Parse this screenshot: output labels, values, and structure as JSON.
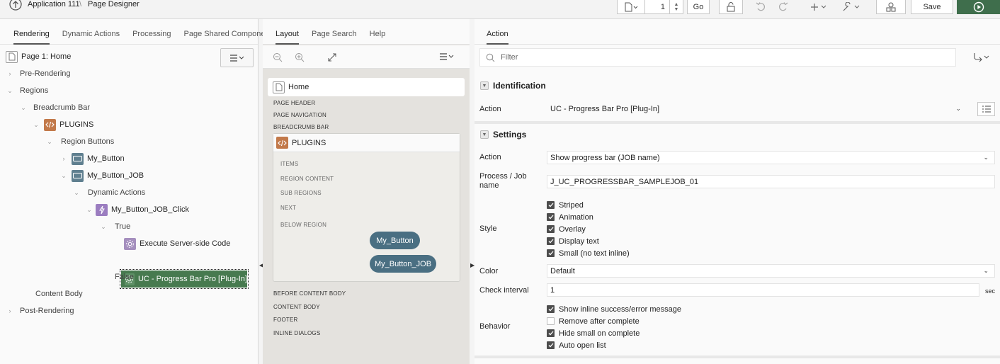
{
  "topbar": {
    "app": "Application 111",
    "separator": "\\",
    "page_title": "Page Designer",
    "page_number": "1",
    "go_label": "Go",
    "save_label": "Save"
  },
  "left": {
    "tabs": [
      "Rendering",
      "Dynamic Actions",
      "Processing",
      "Page Shared Componer"
    ],
    "page_label": "Page 1: Home",
    "tree": {
      "pre_rendering": "Pre-Rendering",
      "regions": "Regions",
      "breadcrumb_bar": "Breadcrumb Bar",
      "plugins": "PLUGINS",
      "region_buttons": "Region Buttons",
      "my_button": "My_Button",
      "my_button_job": "My_Button_JOB",
      "dynamic_actions": "Dynamic Actions",
      "click_da": "My_Button_JOB_Click",
      "true_branch": "True",
      "execute_server": "Execute Server-side Code",
      "uc_progress": "UC - Progress Bar Pro [Plug-In]",
      "false_branch": "False",
      "content_body": "Content Body",
      "post_rendering": "Post-Rendering"
    }
  },
  "mid": {
    "tabs": [
      "Layout",
      "Page Search",
      "Help"
    ],
    "home": "Home",
    "labels_top": [
      "PAGE HEADER",
      "PAGE NAVIGATION",
      "BREADCRUMB BAR"
    ],
    "plugins": "PLUGINS",
    "region_labels": [
      "ITEMS",
      "REGION CONTENT",
      "SUB REGIONS",
      "NEXT",
      "BELOW REGION"
    ],
    "buttons": [
      "My_Button",
      "My_Button_JOB"
    ],
    "labels_bottom": [
      "BEFORE CONTENT BODY",
      "CONTENT BODY",
      "FOOTER",
      "INLINE DIALOGS"
    ]
  },
  "right": {
    "tab": "Action",
    "filter_placeholder": "Filter",
    "identification": {
      "title": "Identification",
      "action_label": "Action",
      "action_value": "UC - Progress Bar Pro [Plug-In]"
    },
    "settings": {
      "title": "Settings",
      "action_label": "Action",
      "action_value": "Show progress bar (JOB name)",
      "process_label": "Process / Job name",
      "process_value": "J_UC_PROGRESSBAR_SAMPLEJOB_01",
      "style_label": "Style",
      "style_options": [
        {
          "label": "Striped",
          "checked": true
        },
        {
          "label": "Animation",
          "checked": true
        },
        {
          "label": "Overlay",
          "checked": true
        },
        {
          "label": "Display text",
          "checked": true
        },
        {
          "label": "Small (no text inline)",
          "checked": true
        }
      ],
      "color_label": "Color",
      "color_value": "Default",
      "interval_label": "Check interval",
      "interval_value": "1",
      "interval_unit": "sec",
      "behavior_label": "Behavior",
      "behavior_options": [
        {
          "label": "Show inline success/error message",
          "checked": true
        },
        {
          "label": "Remove after complete",
          "checked": false
        },
        {
          "label": "Hide small on complete",
          "checked": true
        },
        {
          "label": "Auto open list",
          "checked": true
        }
      ]
    }
  },
  "colors": {
    "run_button": "#3f6e4c",
    "selected_node": "#477a4f",
    "plugin_icon": "#c2794a",
    "button_icon": "#5f7f8f",
    "da_icon": "#9b7dc0",
    "pill": "#4a6f82"
  }
}
